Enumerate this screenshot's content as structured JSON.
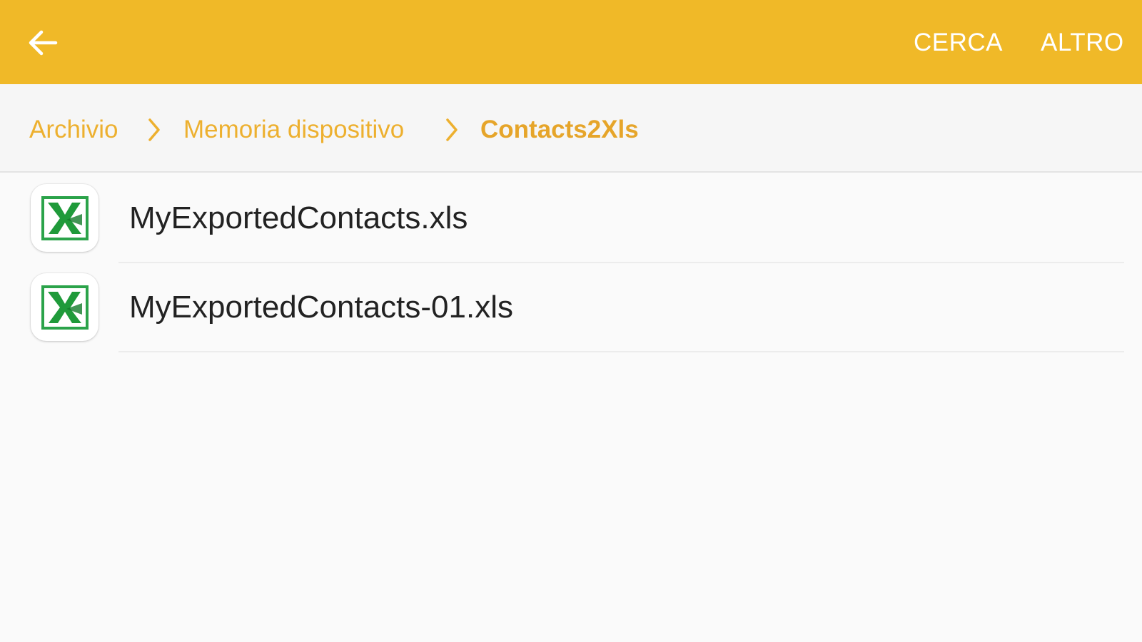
{
  "appbar": {
    "back_icon": "arrow-left-icon",
    "actions": [
      {
        "label": "CERCA"
      },
      {
        "label": "ALTRO"
      }
    ]
  },
  "breadcrumb": {
    "items": [
      {
        "label": "Archivio"
      },
      {
        "label": "Memoria dispositivo"
      },
      {
        "label": "Contacts2Xls"
      }
    ],
    "separator_icon": "chevron-right-icon"
  },
  "files": [
    {
      "name": "MyExportedContacts.xls",
      "icon": "excel-file-icon"
    },
    {
      "name": "MyExportedContacts-01.xls",
      "icon": "excel-file-icon"
    }
  ],
  "colors": {
    "appbar": "#f0b928",
    "breadcrumb_text": "#edb02f",
    "excel_green": "#1f9a3a"
  }
}
